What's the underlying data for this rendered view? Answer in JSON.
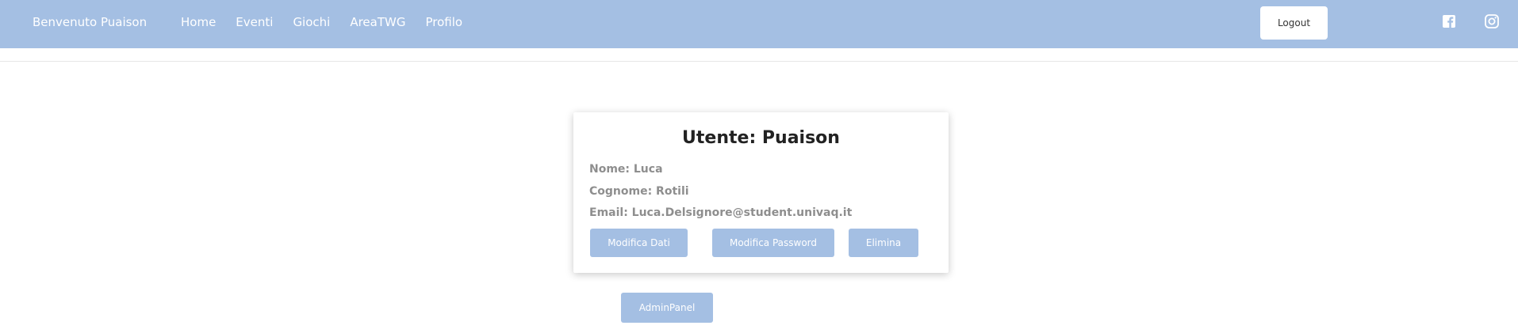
{
  "header": {
    "brand": "Benvenuto Puaison",
    "nav": [
      "Home",
      "Eventi",
      "Giochi",
      "AreaTWG",
      "Profilo"
    ],
    "logout_label": "Logout",
    "icons": [
      "facebook-icon",
      "instagram-icon"
    ]
  },
  "profile": {
    "title": "Utente: Puaison",
    "nome": "Nome: Luca",
    "cognome": "Cognome: Rotili",
    "email": "Email: Luca.Delsignore@student.univaq.it",
    "buttons": {
      "edit_data": "Modifica Dati",
      "edit_password": "Modifica Password",
      "delete": "Elimina"
    }
  },
  "admin_button": "AdminPanel",
  "colors": {
    "header_bg": "#a4bfe3",
    "button_bg": "#a4bfe3",
    "info_text": "#8e8e8e"
  }
}
